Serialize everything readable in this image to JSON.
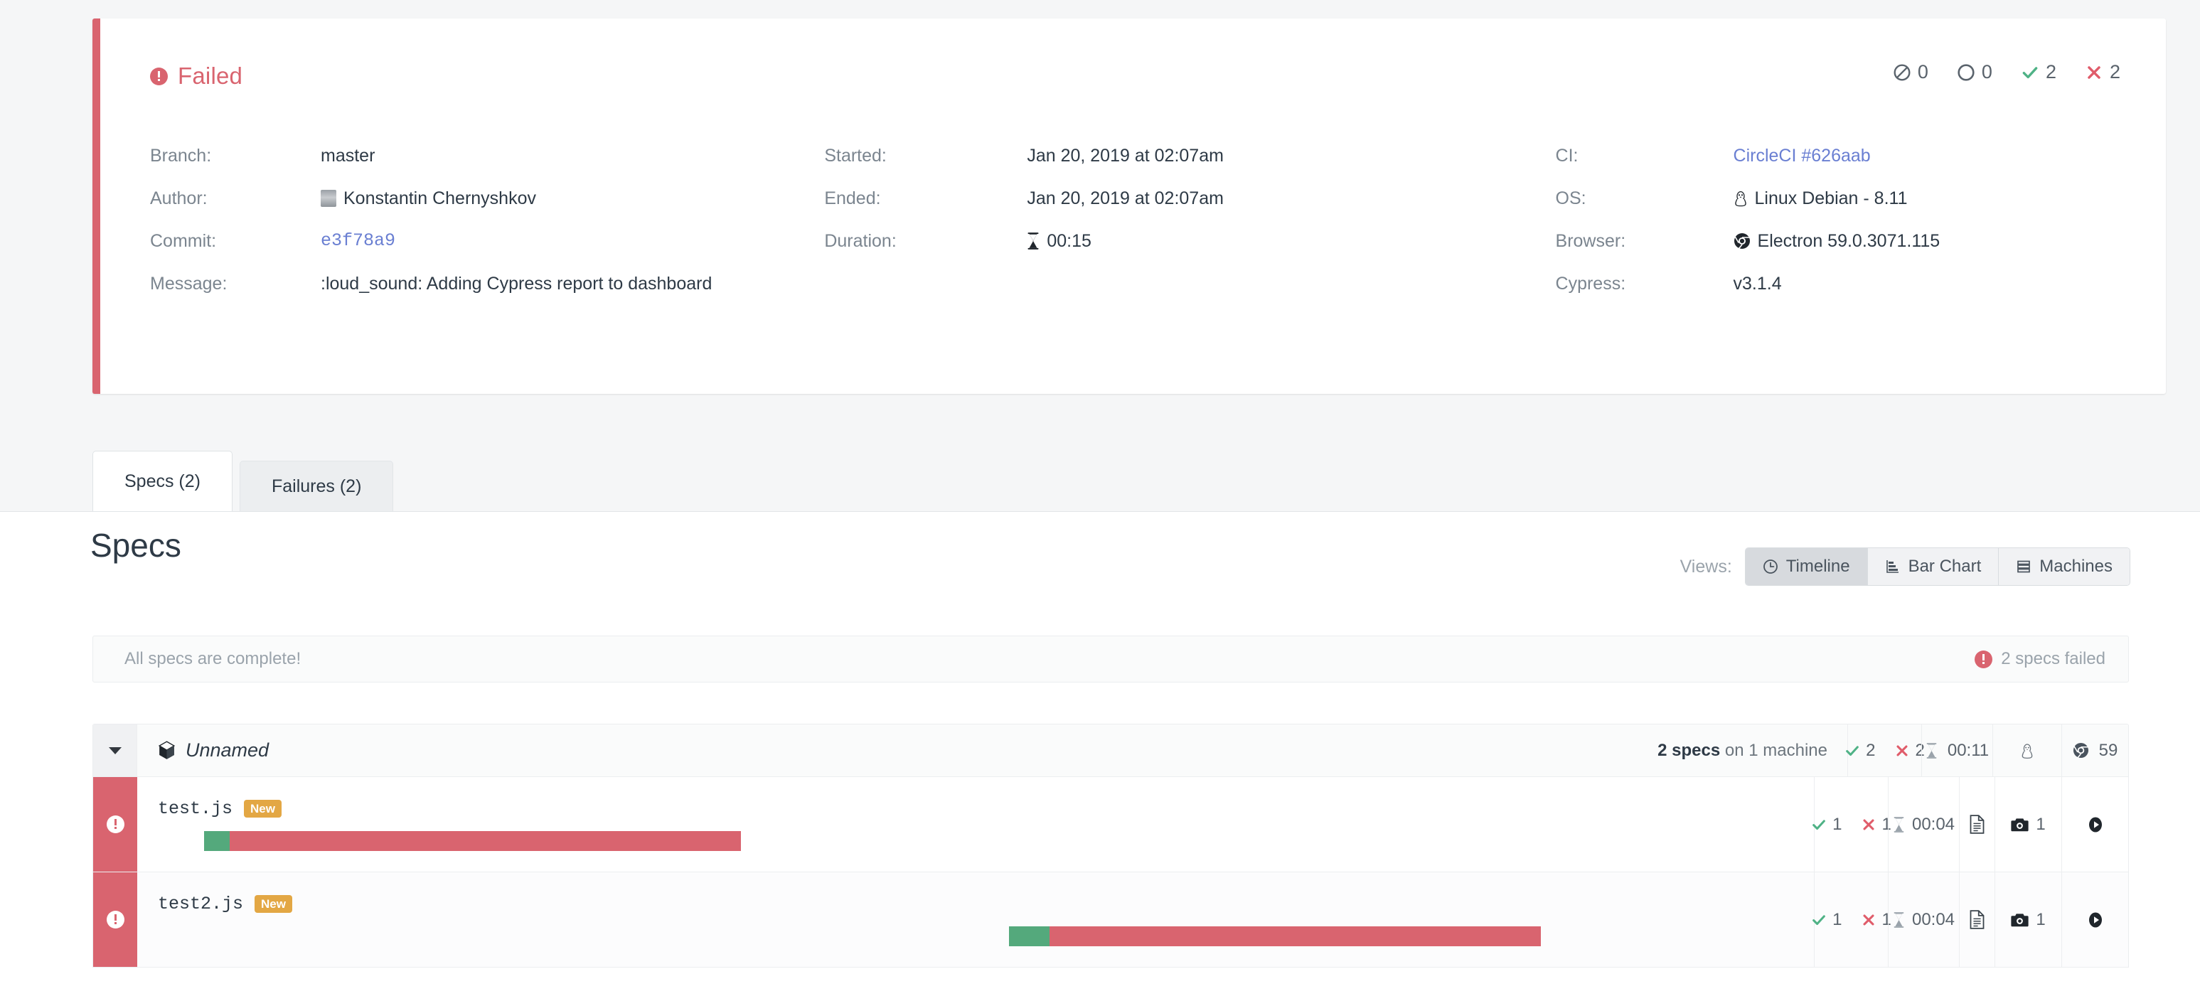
{
  "run": {
    "status_label": "Failed",
    "status_color": "#d9646f",
    "stats": [
      {
        "icon": "skipped-icon",
        "value": "0"
      },
      {
        "icon": "pending-icon",
        "value": "0"
      },
      {
        "icon": "passed-icon",
        "value": "2"
      },
      {
        "icon": "failed-icon",
        "value": "2"
      }
    ],
    "meta_col1": [
      {
        "key": "Branch:",
        "value": "master",
        "style": "plain"
      },
      {
        "key": "Author:",
        "value": "Konstantin Chernyshkov",
        "style": "avatar"
      },
      {
        "key": "Commit:",
        "value": "e3f78a9",
        "style": "mono-link"
      },
      {
        "key": "Message:",
        "value": ":loud_sound: Adding Cypress report to dashboard",
        "style": "plain"
      }
    ],
    "meta_col2": [
      {
        "key": "Started:",
        "value": "Jan 20, 2019 at 02:07am",
        "style": "plain"
      },
      {
        "key": "Ended:",
        "value": "Jan 20, 2019 at 02:07am",
        "style": "plain"
      },
      {
        "key": "Duration:",
        "value": "00:15",
        "style": "hourglass"
      }
    ],
    "meta_col3": [
      {
        "key": "CI:",
        "value": "CircleCI #626aab",
        "style": "link"
      },
      {
        "key": "OS:",
        "value": "Linux Debian - 8.11",
        "style": "linux"
      },
      {
        "key": "Browser:",
        "value": "Electron 59.0.3071.115",
        "style": "chrome"
      },
      {
        "key": "Cypress:",
        "value": "v3.1.4",
        "style": "plain"
      }
    ]
  },
  "tabs": [
    {
      "label": "Specs (2)",
      "active": true
    },
    {
      "label": "Failures (2)",
      "active": false
    }
  ],
  "specs_panel": {
    "title": "Specs",
    "views_label": "Views:",
    "views": [
      {
        "label": "Timeline",
        "icon": "clock-icon",
        "active": true
      },
      {
        "label": "Bar Chart",
        "icon": "bar-chart-icon",
        "active": false
      },
      {
        "label": "Machines",
        "icon": "server-icon",
        "active": false
      }
    ],
    "status_left": "All specs are complete!",
    "status_right": "2 specs failed"
  },
  "spec_table": {
    "group": {
      "name": "Unnamed",
      "machines_prefix": "2 specs",
      "machines_suffix": "on 1 machine",
      "passed": "2",
      "failed": "2",
      "duration": "00:11",
      "os": "linux-icon",
      "browser_version": "59"
    },
    "rows": [
      {
        "file": "test.js",
        "badge": "New",
        "passed": "1",
        "failed": "1",
        "duration": "00:04",
        "screenshots": "1",
        "timeline": {
          "left_pct": 4.0,
          "pass_pct": 1.5,
          "fail_pct": 30.5
        }
      },
      {
        "file": "test2.js",
        "badge": "New",
        "passed": "1",
        "failed": "1",
        "duration": "00:04",
        "screenshots": "1",
        "timeline": {
          "left_pct": 52.0,
          "pass_pct": 2.4,
          "fail_pct": 29.3
        }
      }
    ]
  }
}
